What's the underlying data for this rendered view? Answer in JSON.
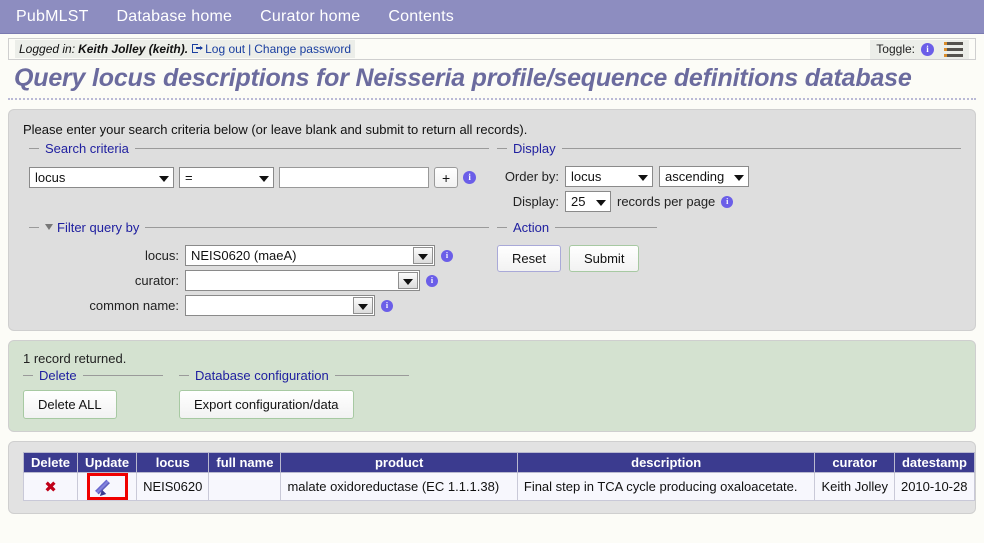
{
  "nav": {
    "items": [
      {
        "label": "PubMLST",
        "name": "nav-pubmlst"
      },
      {
        "label": "Database home",
        "name": "nav-database-home"
      },
      {
        "label": "Curator home",
        "name": "nav-curator-home"
      },
      {
        "label": "Contents",
        "name": "nav-contents"
      }
    ]
  },
  "login": {
    "prefix": "Logged in:",
    "user": "Keith Jolley (keith).",
    "logout": "Log out",
    "separator": "|",
    "change_password": "Change password",
    "toggle_label": "Toggle:",
    "info_glyph": "i",
    "logout_icon": "logout-arrow-icon",
    "menu_icon": "hamburger-menu-icon"
  },
  "page": {
    "title": "Query locus descriptions for Neisseria profile/sequence definitions database"
  },
  "form": {
    "intro": "Please enter your search criteria below (or leave blank and submit to return all records).",
    "search_criteria": {
      "legend": "Search criteria",
      "field_value": "locus",
      "operator_value": "=",
      "term_value": "",
      "term_placeholder": "",
      "add_label": "+",
      "info_glyph": "i"
    },
    "display": {
      "legend": "Display",
      "order_by_label": "Order by:",
      "order_by_value": "locus",
      "direction_value": "ascending",
      "display_label": "Display:",
      "page_size_value": "25",
      "records_per_page": "records per page",
      "info_glyph": "i"
    },
    "filter": {
      "legend": "Filter query by",
      "rows": [
        {
          "label": "locus:",
          "value": "NEIS0620 (maeA)",
          "name": "filter-locus"
        },
        {
          "label": "curator:",
          "value": "",
          "name": "filter-curator"
        },
        {
          "label": "common name:",
          "value": "",
          "name": "filter-common-name"
        }
      ],
      "info_glyph": "i"
    },
    "action": {
      "legend": "Action",
      "reset_label": "Reset",
      "submit_label": "Submit"
    }
  },
  "results": {
    "record_count_text": "1 record returned.",
    "delete": {
      "legend": "Delete",
      "button_label": "Delete ALL"
    },
    "db_config": {
      "legend": "Database configuration",
      "button_label": "Export configuration/data"
    },
    "table": {
      "headers": [
        "Delete",
        "Update",
        "locus",
        "full name",
        "product",
        "description",
        "curator",
        "datestamp"
      ],
      "rows": [
        {
          "delete_icon": "delete-cross-icon",
          "update_icon": "edit-pencil-icon",
          "locus": "NEIS0620",
          "full_name": "",
          "product": "malate oxidoreductase (EC 1.1.1.38)",
          "description": "Final step in TCA cycle producing oxaloacetate.",
          "curator": "Keith Jolley",
          "datestamp": "2010-10-28"
        }
      ]
    }
  },
  "colors": {
    "navbar": "#8d8dc0",
    "title": "#6b6b9e",
    "legend": "#2020a0",
    "table_header": "#3b3b8f",
    "highlight": "#f00000",
    "info_badge": "#6b5ee8",
    "results_panel": "#d4e2d0"
  }
}
